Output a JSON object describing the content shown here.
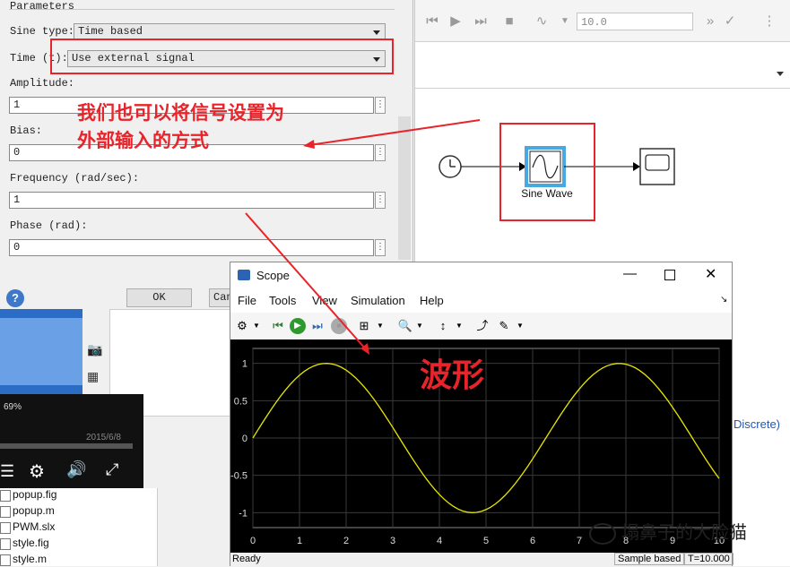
{
  "dialog": {
    "section_title": "Parameters",
    "sine_type_label": "Sine type:",
    "sine_type_value": "Time based",
    "time_label": "Time (t):",
    "time_value": "Use external signal",
    "amplitude_label": "Amplitude:",
    "amplitude_value": "1",
    "bias_label": "Bias:",
    "bias_value": "0",
    "frequency_label": "Frequency (rad/sec):",
    "frequency_value": "1",
    "phase_label": "Phase (rad):",
    "phase_value": "0",
    "ok_label": "OK",
    "cancel_label": "Can",
    "more_glyph": "⋮"
  },
  "simulink": {
    "stop_time": "10.0",
    "status": "Ready",
    "discrete_text": "Discrete)",
    "block_label": "Sine Wave"
  },
  "player": {
    "zoom": "69%",
    "date": "2015/6/8"
  },
  "files": [
    {
      "name": "popup.fig"
    },
    {
      "name": "popup.m"
    },
    {
      "name": "PWM.slx"
    },
    {
      "name": "style.fig"
    },
    {
      "name": "style.m"
    }
  ],
  "scope": {
    "title": "Scope",
    "menu": [
      "File",
      "Tools",
      "View",
      "Simulation",
      "Help"
    ],
    "status": "Ready",
    "sample_mode": "Sample based",
    "time_readout": "T=10.000"
  },
  "annotations": {
    "note_line1": "我们也可以将信号设置为",
    "note_line2": "外部输入的方式",
    "waveform": "波形",
    "watermark": "塌鼻子的大脸猫"
  },
  "colors": {
    "annotation_red": "#e8242a",
    "trace": "#e6e600",
    "plot_bg": "#000000",
    "block_highlight": "#4aa8e0"
  },
  "chart_data": {
    "type": "line",
    "x_ticks": [
      "0",
      "1",
      "2",
      "3",
      "4",
      "5",
      "6",
      "7",
      "8",
      "9",
      "10"
    ],
    "y_ticks": [
      "1",
      "0.5",
      "0",
      "-0.5",
      "-1"
    ],
    "xlim": [
      0,
      10
    ],
    "ylim": [
      -1.2,
      1.2
    ],
    "grid": true,
    "series": [
      {
        "function": "sin(t)",
        "x_start": 0,
        "x_end": 10,
        "samples": 101
      }
    ]
  }
}
